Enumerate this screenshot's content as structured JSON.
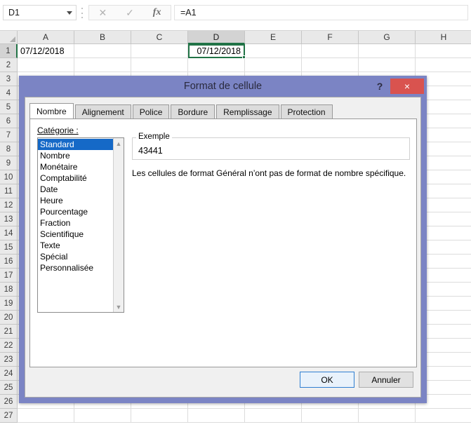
{
  "formula_bar": {
    "name_box_value": "D1",
    "name_box_placeholder": "Zone Nom",
    "cancel_icon": "close-icon",
    "enter_icon": "check-icon",
    "function_icon": "fx",
    "formula_value": "=A1",
    "formula_placeholder": ""
  },
  "grid": {
    "columns": [
      "A",
      "B",
      "C",
      "D",
      "E",
      "F",
      "G",
      "H"
    ],
    "selected_column": "D",
    "rows": [
      1,
      2,
      3,
      4,
      5,
      6,
      7,
      8,
      9,
      10,
      11,
      12,
      13,
      14,
      15,
      16,
      17,
      18,
      19,
      20,
      21,
      22,
      23,
      24,
      25,
      26,
      27
    ],
    "selected_row": 1,
    "cells": [
      {
        "col": "A",
        "row": 1,
        "value": "07/12/2018",
        "align": "left",
        "active": false
      },
      {
        "col": "D",
        "row": 1,
        "value": "07/12/2018",
        "align": "right",
        "active": true
      }
    ]
  },
  "dialog": {
    "title": "Format de cellule",
    "help_label": "?",
    "close_label": "×",
    "tabs": [
      {
        "label": "Nombre",
        "active": true
      },
      {
        "label": "Alignement",
        "active": false
      },
      {
        "label": "Police",
        "active": false
      },
      {
        "label": "Bordure",
        "active": false
      },
      {
        "label": "Remplissage",
        "active": false
      },
      {
        "label": "Protection",
        "active": false
      }
    ],
    "category_label": "Catégorie :",
    "categories": [
      {
        "label": "Standard",
        "selected": true
      },
      {
        "label": "Nombre",
        "selected": false
      },
      {
        "label": "Monétaire",
        "selected": false
      },
      {
        "label": "Comptabilité",
        "selected": false
      },
      {
        "label": "Date",
        "selected": false
      },
      {
        "label": "Heure",
        "selected": false
      },
      {
        "label": "Pourcentage",
        "selected": false
      },
      {
        "label": "Fraction",
        "selected": false
      },
      {
        "label": "Scientifique",
        "selected": false
      },
      {
        "label": "Texte",
        "selected": false
      },
      {
        "label": "Spécial",
        "selected": false
      },
      {
        "label": "Personnalisée",
        "selected": false
      }
    ],
    "scroll_up_icon": "▲",
    "scroll_down_icon": "▼",
    "example_legend": "Exemple",
    "example_value": "43441",
    "description": "Les cellules de format Général n’ont pas de format de nombre spécifique.",
    "ok_label": "OK",
    "cancel_label": "Annuler"
  },
  "colors": {
    "title_bar": "#7b84c4",
    "close_button": "#d9534f",
    "selection_blue": "#1569c7",
    "excel_green": "#217346",
    "default_button_border": "#2f7fd1"
  }
}
